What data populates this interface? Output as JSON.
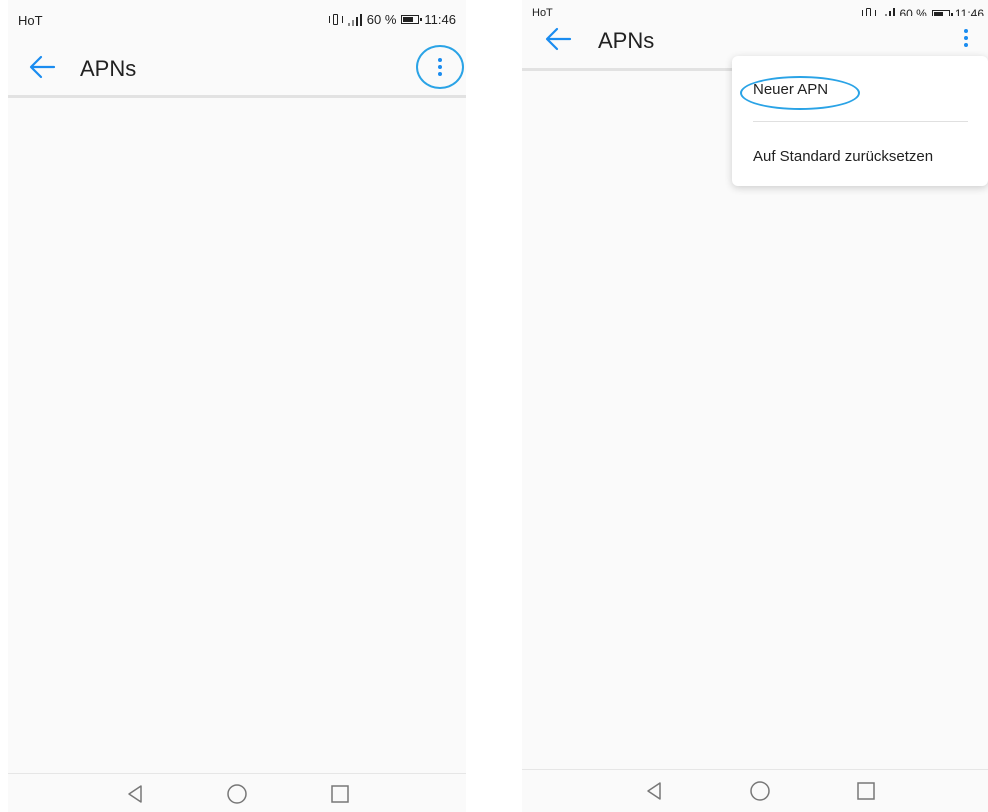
{
  "status_bar": {
    "carrier": "HoT",
    "battery": "60 %",
    "time": "11:46"
  },
  "app_bar": {
    "title": "APNs"
  },
  "overflow_menu": {
    "items": [
      {
        "label": "Neuer APN"
      },
      {
        "label": "Auf Standard zurücksetzen"
      }
    ]
  },
  "colors": {
    "accent": "#1a8cf0",
    "highlight": "#2aa3e6",
    "background": "#fafafa"
  },
  "icons": [
    "back-arrow-icon",
    "more-vert-icon",
    "vibrate-icon",
    "signal-icon",
    "battery-icon",
    "nav-back-icon",
    "nav-home-icon",
    "nav-recents-icon"
  ]
}
